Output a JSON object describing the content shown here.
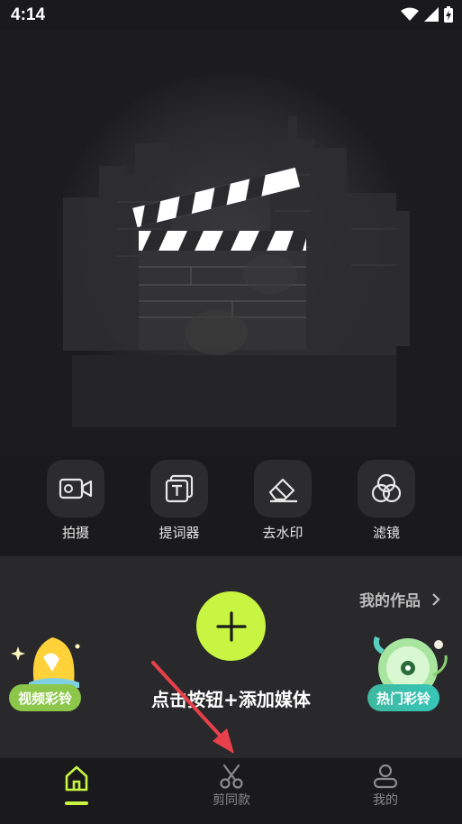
{
  "status_bar": {
    "time": "4:14",
    "icons": [
      "wifi-icon",
      "signal-icon",
      "battery-charging-icon"
    ]
  },
  "tools": [
    {
      "label": "拍摄",
      "icon": "camera-icon"
    },
    {
      "label": "提词器",
      "icon": "teleprompter-icon"
    },
    {
      "label": "去水印",
      "icon": "eraser-icon"
    },
    {
      "label": "滤镜",
      "icon": "filter-icon"
    }
  ],
  "panel": {
    "my_works": "我的作品",
    "hint": "点击按钮+添加媒体",
    "left_badge": "视频彩铃",
    "right_badge": "热门彩铃"
  },
  "nav": {
    "items": [
      {
        "label": "",
        "icon": "home-icon",
        "active": true
      },
      {
        "label": "剪同款",
        "icon": "scissors-icon"
      },
      {
        "label": "我的",
        "icon": "profile-icon"
      }
    ]
  },
  "colors": {
    "accent": "#c8f542",
    "annotation_arrow": "#e8404a"
  }
}
